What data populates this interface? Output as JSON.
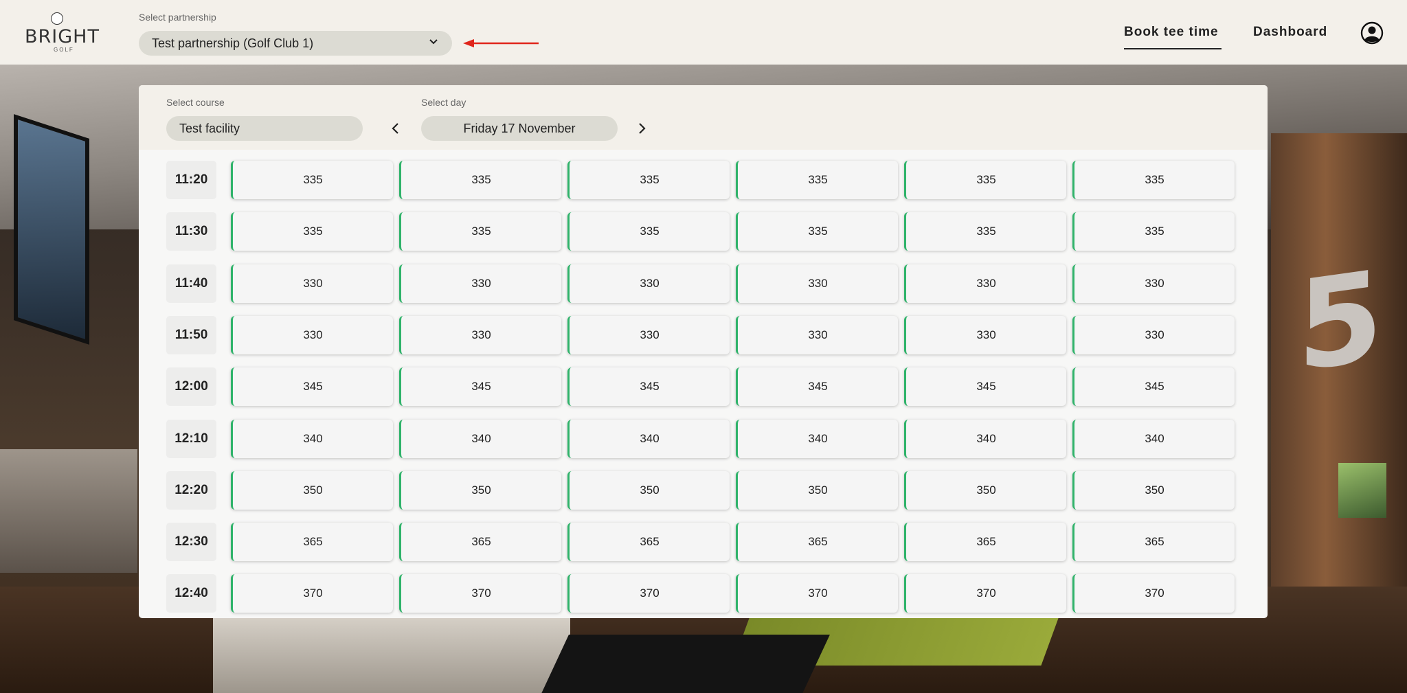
{
  "app": {
    "logo_text": "BRIGHT",
    "logo_sub": "GOLF"
  },
  "header": {
    "partnership_label": "Select partnership",
    "partnership_value": "Test partnership (Golf Club 1)",
    "nav": [
      {
        "label": "Book tee time",
        "active": true
      },
      {
        "label": "Dashboard",
        "active": false
      }
    ],
    "annotation_arrow_color": "#e0251b"
  },
  "filters": {
    "course_label": "Select course",
    "course_value": "Test facility",
    "day_label": "Select day",
    "day_value": "Friday 17 November"
  },
  "colors": {
    "slot_accent": "#2fb36a",
    "header_bg": "#f3f0ea",
    "select_bg": "#dcdbd3"
  },
  "tee_times": [
    {
      "time": "11:20",
      "prices": [
        "335",
        "335",
        "335",
        "335",
        "335",
        "335"
      ]
    },
    {
      "time": "11:30",
      "prices": [
        "335",
        "335",
        "335",
        "335",
        "335",
        "335"
      ]
    },
    {
      "time": "11:40",
      "prices": [
        "330",
        "330",
        "330",
        "330",
        "330",
        "330"
      ]
    },
    {
      "time": "11:50",
      "prices": [
        "330",
        "330",
        "330",
        "330",
        "330",
        "330"
      ]
    },
    {
      "time": "12:00",
      "prices": [
        "345",
        "345",
        "345",
        "345",
        "345",
        "345"
      ]
    },
    {
      "time": "12:10",
      "prices": [
        "340",
        "340",
        "340",
        "340",
        "340",
        "340"
      ]
    },
    {
      "time": "12:20",
      "prices": [
        "350",
        "350",
        "350",
        "350",
        "350",
        "350"
      ]
    },
    {
      "time": "12:30",
      "prices": [
        "365",
        "365",
        "365",
        "365",
        "365",
        "365"
      ]
    },
    {
      "time": "12:40",
      "prices": [
        "370",
        "370",
        "370",
        "370",
        "370",
        "370"
      ]
    }
  ]
}
